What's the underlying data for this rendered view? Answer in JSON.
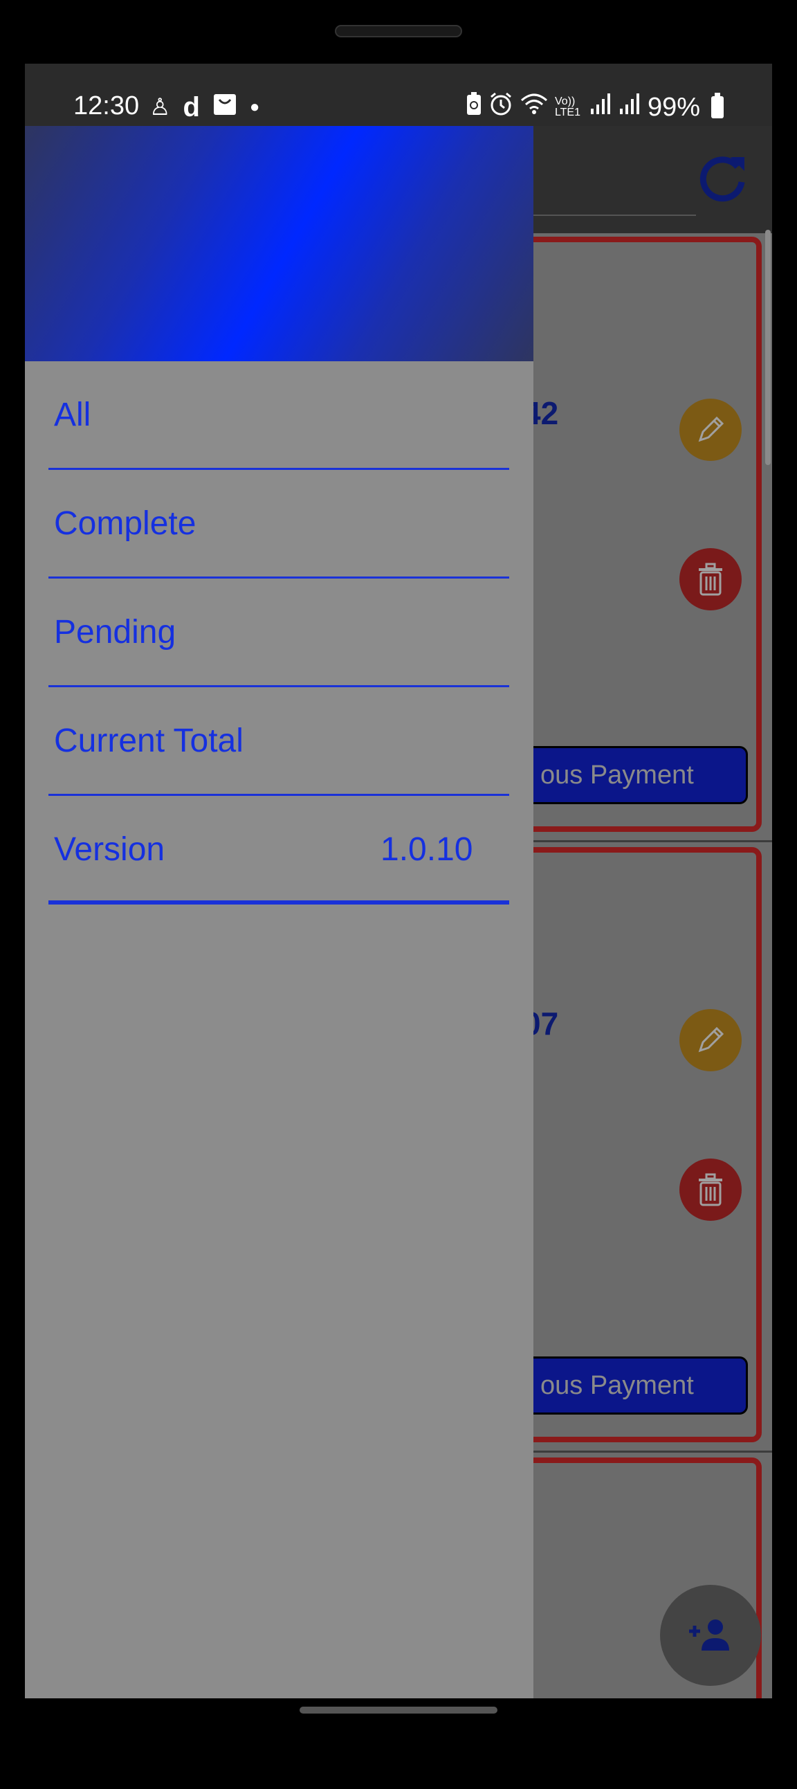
{
  "status_bar": {
    "time": "12:30",
    "left_icons": [
      "person-icon",
      "d-app-icon",
      "shopping-bag-icon",
      "dot-icon"
    ],
    "right_icons": [
      "battery-saver-icon",
      "alarm-icon",
      "wifi-icon",
      "volte-icon",
      "signal-icon",
      "signal-icon"
    ],
    "volte_label": "Vo)) LTE1",
    "battery_percent": "99%"
  },
  "drawer": {
    "items": [
      {
        "label": "All"
      },
      {
        "label": "Complete"
      },
      {
        "label": "Pending"
      },
      {
        "label": "Current Total"
      },
      {
        "label": "Version",
        "value": "1.0.10"
      }
    ]
  },
  "background": {
    "cards": [
      {
        "number_fragment": "42",
        "button_label": "ous Payment"
      },
      {
        "number_fragment": "07",
        "button_label": "ous Payment"
      }
    ]
  },
  "colors": {
    "accent_blue": "#1530e0",
    "card_border": "#8a1a1a",
    "drawer_bg": "#8c8c8c"
  }
}
